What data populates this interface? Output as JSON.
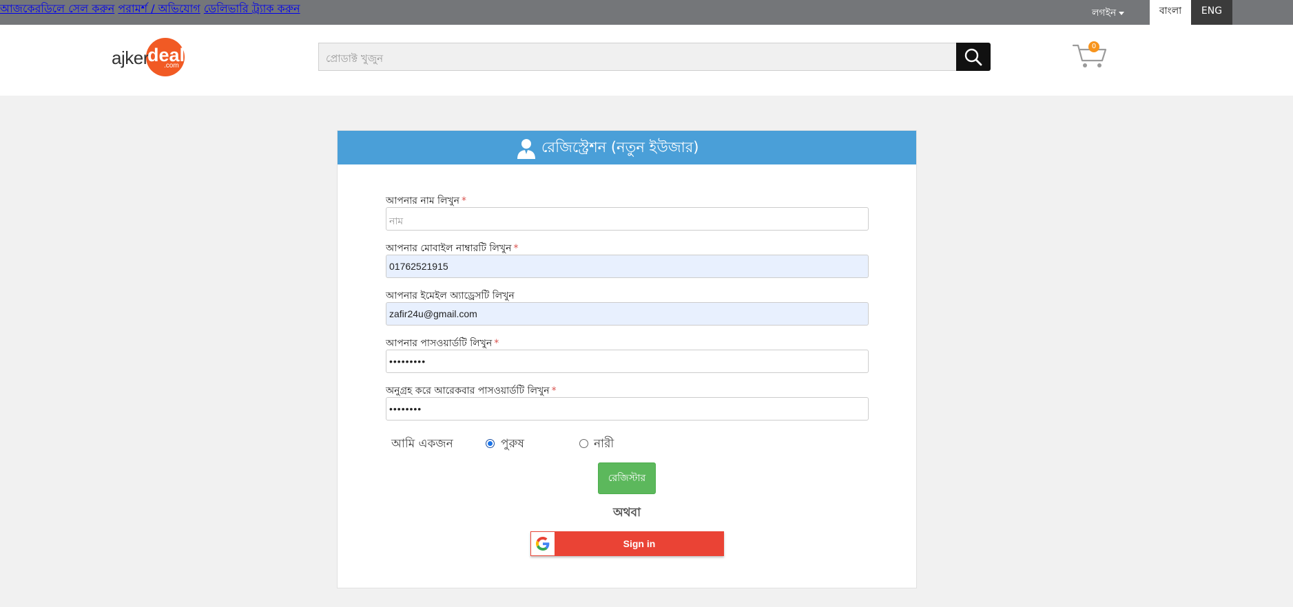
{
  "topbar": {
    "sell_link": "আজকেরডিলে সেল করুন",
    "feedback_link": "পরামর্শ / অভিযোগ",
    "track_link": "ডেলিভারি ট্র্যাক করুন",
    "login_link": "লগইন",
    "lang_bangla": "বাংলা",
    "lang_english": "ENG"
  },
  "header": {
    "logo": {
      "text_left": "ajker",
      "text_right": "deal",
      "suffix": ".com"
    },
    "search": {
      "placeholder": "প্রোডাক্ট খুজুন"
    },
    "cart": {
      "count": "0"
    }
  },
  "registration": {
    "title": "রেজিস্ট্রেশন (নতুন ইউজার)",
    "fields": [
      {
        "label": "আপনার নাম লিখুন",
        "required": "*",
        "value": "",
        "placeholder": "নাম"
      },
      {
        "label": "আপনার মোবাইল নাম্বারটি লিখুন",
        "required": "*",
        "value": "01762521915",
        "placeholder": ""
      },
      {
        "label": "আপনার ইমেইল অ্যাড্রেসটি লিখুন",
        "required": "",
        "value": "zafir24u@gmail.com",
        "placeholder": ""
      },
      {
        "label": "আপনার পাসওয়ার্ডটি লিখুন",
        "required": "*",
        "value": "•••••••••",
        "placeholder": ""
      },
      {
        "label": "অনুগ্রহ করে আরেকবার পাসওয়ার্ডটি লিখুন",
        "required": "*",
        "value": "••••••••",
        "placeholder": ""
      }
    ],
    "gender": {
      "label": "আমি একজন",
      "options": [
        {
          "label": "পুরুষ",
          "selected": true
        },
        {
          "label": "নারী",
          "selected": false
        }
      ]
    },
    "register_button": "রেজিস্টার",
    "or_text": "অথবা",
    "google_signin": "Sign in"
  },
  "colors": {
    "topbar": "#747679",
    "card_header": "#4a9fd8",
    "register_button": "#5cb85c",
    "google_button": "#ea4335",
    "logo_orange": "#f15a24"
  }
}
